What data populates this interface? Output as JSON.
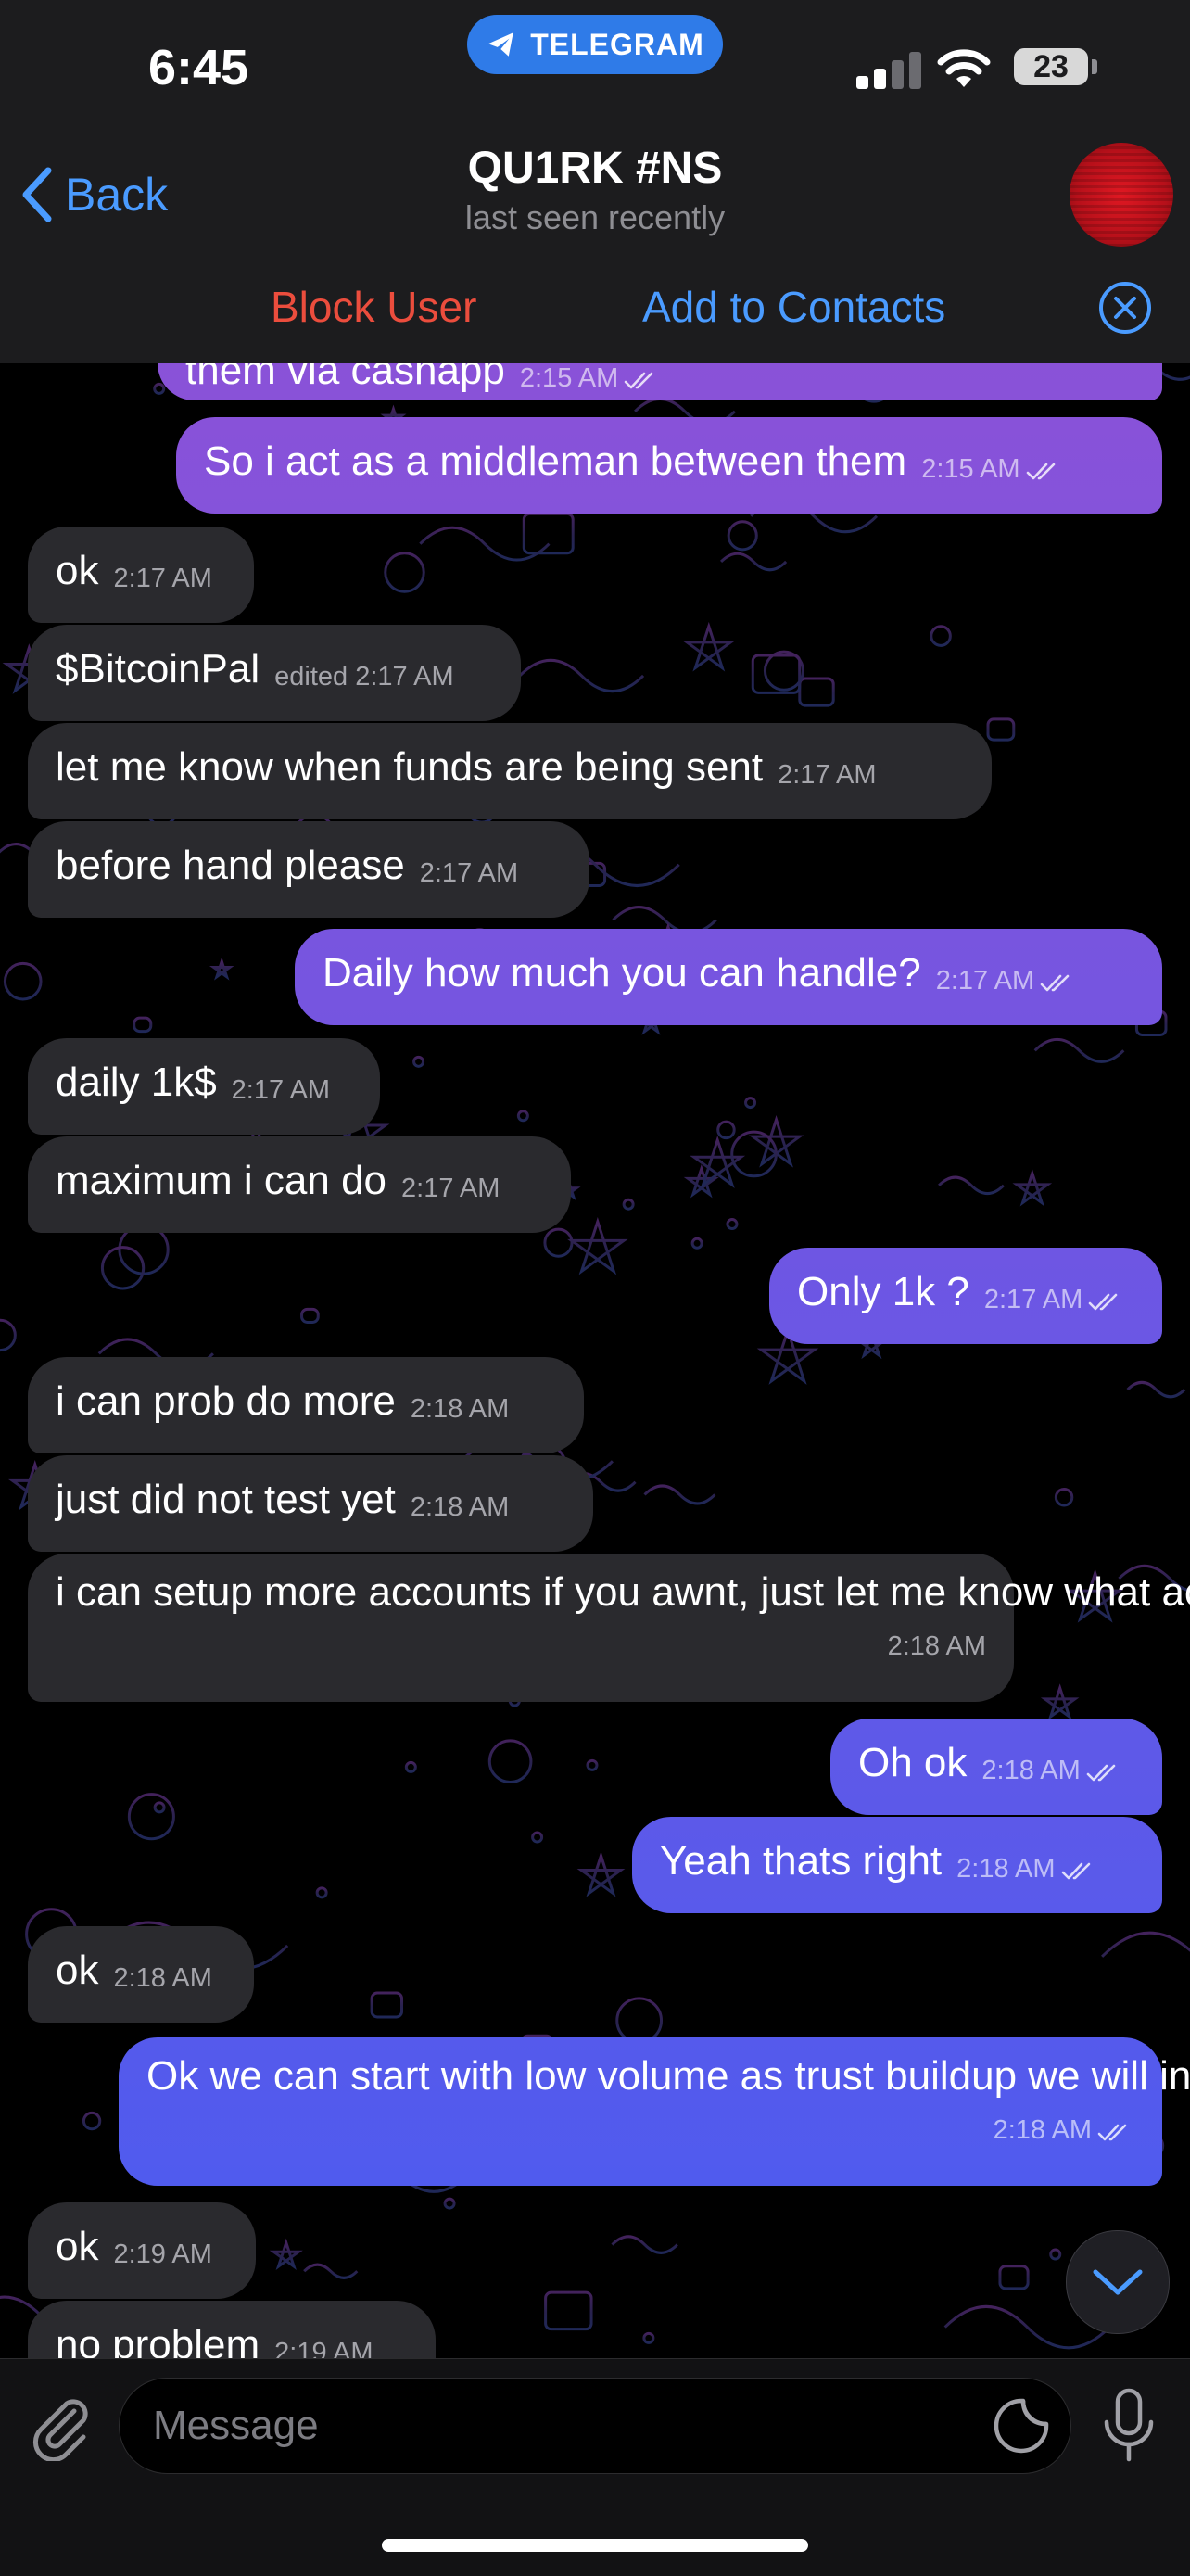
{
  "status_bar": {
    "time": "6:45",
    "app_pill": "TELEGRAM",
    "battery": "23"
  },
  "header": {
    "back_label": "Back",
    "title": "QU1RK #NS",
    "subtitle": "last seen recently"
  },
  "action_bar": {
    "block_label": "Block User",
    "add_contacts_label": "Add to Contacts"
  },
  "messages": [
    {
      "dir": "out",
      "text": "them via cashapp",
      "time": "2:15 AM"
    },
    {
      "dir": "out",
      "text": "So i act as a middleman between them",
      "time": "2:15 AM"
    },
    {
      "dir": "in",
      "text": "ok",
      "time": "2:17 AM"
    },
    {
      "dir": "in",
      "text": "$BitcoinPal",
      "time": "edited 2:17 AM"
    },
    {
      "dir": "in",
      "text": "let me know when funds are being sent",
      "time": "2:17 AM"
    },
    {
      "dir": "in",
      "text": "before hand please",
      "time": "2:17 AM"
    },
    {
      "dir": "out",
      "text": "Daily how much you can handle?",
      "time": "2:17 AM"
    },
    {
      "dir": "in",
      "text": "daily 1k$",
      "time": "2:17 AM"
    },
    {
      "dir": "in",
      "text": "maximum i can do",
      "time": "2:17 AM"
    },
    {
      "dir": "out",
      "text": "Only 1k ?",
      "time": "2:17 AM"
    },
    {
      "dir": "in",
      "text": "i can prob do more",
      "time": "2:18 AM"
    },
    {
      "dir": "in",
      "text": "just did not test yet",
      "time": "2:18 AM"
    },
    {
      "dir": "in",
      "text": "i can setup more accounts if you awnt, just let me know what account",
      "time": "2:18 AM"
    },
    {
      "dir": "out",
      "text": "Oh ok",
      "time": "2:18 AM"
    },
    {
      "dir": "out",
      "text": "Yeah thats right",
      "time": "2:18 AM"
    },
    {
      "dir": "in",
      "text": "ok",
      "time": "2:18 AM"
    },
    {
      "dir": "out",
      "text": "Ok we can start with low volume as trust buildup we will increase more",
      "time": "2:18 AM"
    },
    {
      "dir": "in",
      "text": "ok",
      "time": "2:19 AM"
    },
    {
      "dir": "in",
      "text": "no problem",
      "time": "2:19 AM"
    }
  ],
  "input": {
    "placeholder": "Message"
  },
  "colors": {
    "accent": "#4a9bff",
    "block": "#eb4d3d",
    "incoming_bubble": "#2a2a2e",
    "outgoing_top": "#8a52d8",
    "outgoing_bottom": "#4b5cf0"
  },
  "icons": {
    "back": "chevron-left-icon",
    "close": "close-circle-icon",
    "attach": "paperclip-icon",
    "sticker": "sticker-icon",
    "mic": "microphone-icon",
    "scroll": "chevron-down-icon"
  }
}
